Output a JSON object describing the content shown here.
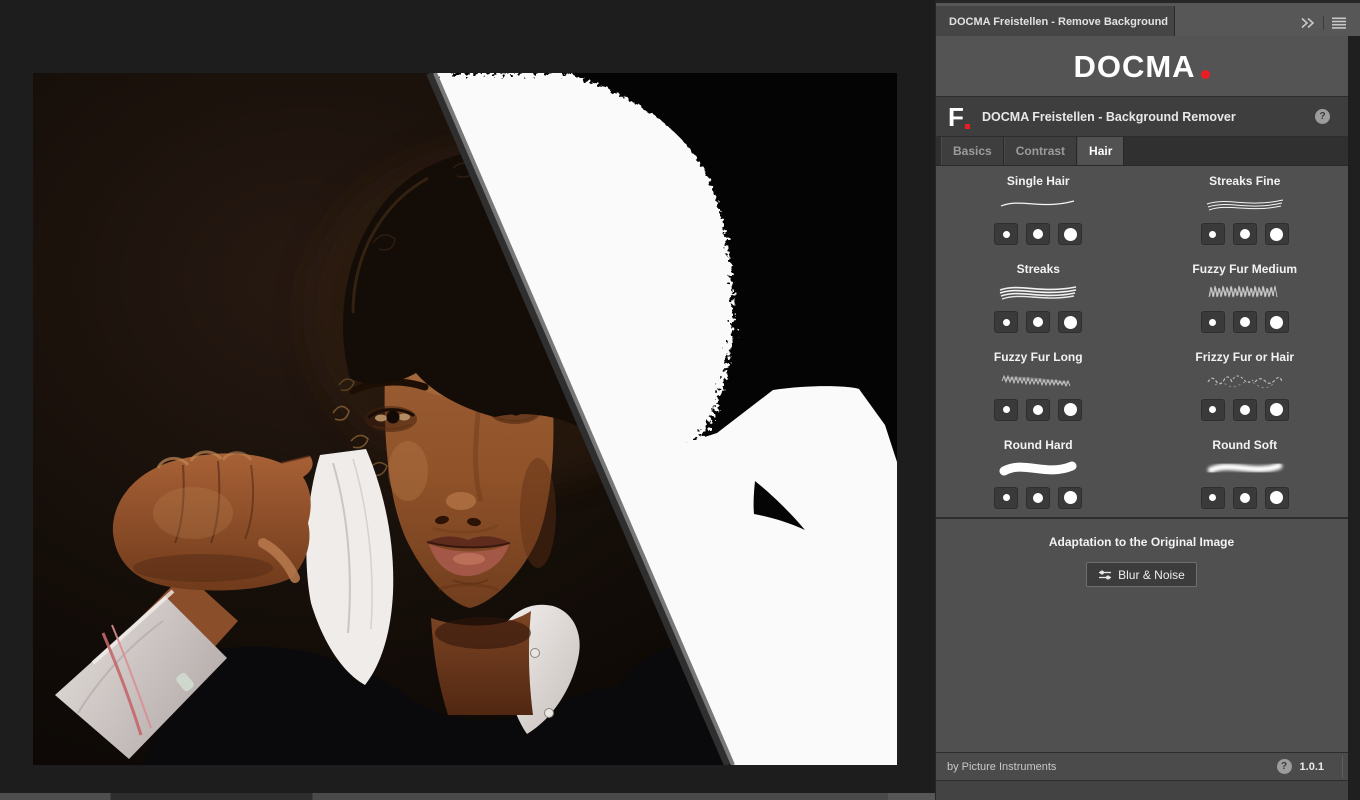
{
  "panel": {
    "tab_title": "DOCMA Freistellen - Remove Background",
    "logo": {
      "text": "DOCMA"
    },
    "plugin": {
      "icon_letter": "F",
      "title": "DOCMA Freistellen - Background Remover"
    },
    "tabs": [
      {
        "label": "Basics",
        "active": false
      },
      {
        "label": "Contrast",
        "active": false
      },
      {
        "label": "Hair",
        "active": true
      }
    ],
    "brush_groups": [
      {
        "label": "Single Hair",
        "preview": "single-hair",
        "sizes": [
          "small",
          "medium",
          "large"
        ]
      },
      {
        "label": "Streaks Fine",
        "preview": "streaks-fine",
        "sizes": [
          "small",
          "medium",
          "large"
        ]
      },
      {
        "label": "Streaks",
        "preview": "streaks",
        "sizes": [
          "small",
          "medium",
          "large"
        ]
      },
      {
        "label": "Fuzzy Fur Medium",
        "preview": "fuzzy-fur-medium",
        "sizes": [
          "small",
          "medium",
          "large"
        ]
      },
      {
        "label": "Fuzzy Fur Long",
        "preview": "fuzzy-fur-long",
        "sizes": [
          "small",
          "medium",
          "large"
        ]
      },
      {
        "label": "Frizzy Fur or Hair",
        "preview": "frizzy-fur-hair",
        "sizes": [
          "small",
          "medium",
          "large"
        ]
      },
      {
        "label": "Round Hard",
        "preview": "round-hard",
        "sizes": [
          "small",
          "medium",
          "large"
        ]
      },
      {
        "label": "Round Soft",
        "preview": "round-soft",
        "sizes": [
          "small",
          "medium",
          "large"
        ]
      }
    ],
    "adaptation": {
      "heading": "Adaptation to the Original Image",
      "button_label": "Blur & Noise"
    },
    "footer": {
      "credit": "by Picture Instruments",
      "version": "1.0.1"
    }
  },
  "icons": {
    "help_glyph": "?"
  },
  "colors": {
    "accent_red": "#ed1c24",
    "panel_bg": "#505050",
    "panel_dark_row": "#3e3e3e",
    "canvas_bg": "#1d1d1d",
    "button_bg": "#3a3a3a",
    "active_tab_text": "#ffffff",
    "inactive_tab_text": "#9c9c9c",
    "mask_white": "#fafafa",
    "mask_black": "#040404",
    "split_line_gray": "#787878"
  }
}
